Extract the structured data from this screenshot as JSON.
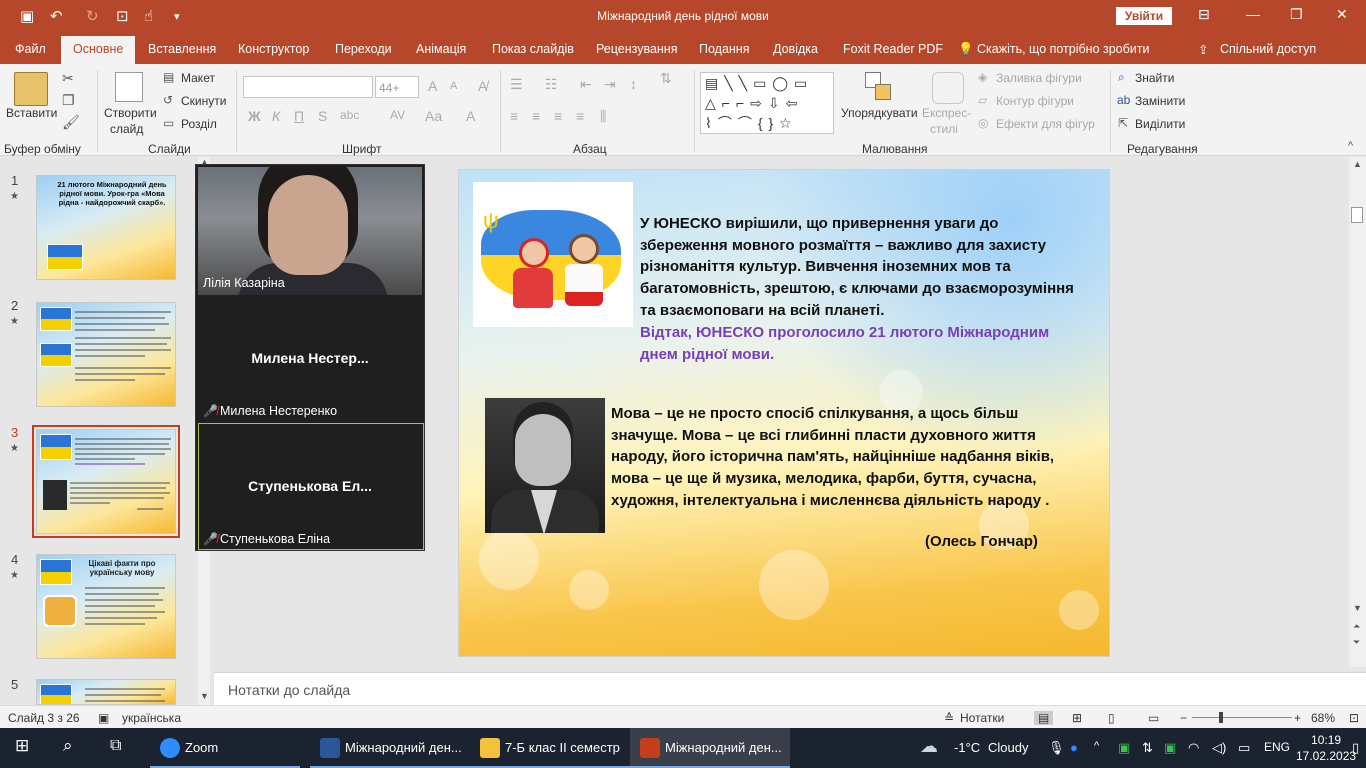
{
  "app": {
    "window_title": "Міжнародний день рідної мови",
    "sign_in": "Увійти"
  },
  "tabs": [
    "Файл",
    "Основне",
    "Вставлення",
    "Конструктор",
    "Переходи",
    "Анімація",
    "Показ слайдів",
    "Рецензування",
    "Подання",
    "Довідка",
    "Foxit Reader PDF"
  ],
  "tell_me": "Скажіть, що потрібно зробити",
  "share": "Спільний доступ",
  "ribbon": {
    "paste": "Вставити",
    "clipboard_group": "Буфер обміну",
    "new_slide_1": "Створити",
    "new_slide_2": "слайд",
    "layout": "Макет",
    "reset": "Скинути",
    "section": "Розділ",
    "slides_group": "Слайди",
    "font_size": "44+",
    "font_group": "Шрифт",
    "paragraph_group": "Абзац",
    "arrange": "Упорядкувати",
    "quick_styles_1": "Експрес-",
    "quick_styles_2": "стилі",
    "shape_fill": "Заливка фігури",
    "shape_outline": "Контур фігури",
    "shape_effects": "Ефекти для фігур",
    "drawing_group": "Малювання",
    "find": "Знайти",
    "replace": "Замінити",
    "select": "Виділити",
    "editing_group": "Редагування",
    "bold": "Ж",
    "italic": "К",
    "underline": "П"
  },
  "thumbnails": [
    {
      "num": "1",
      "title": "21 лютого Міжнародний день рідної мови. Урок-гра «Мова рідна - найдорожчий скарб»."
    },
    {
      "num": "2",
      "title": ""
    },
    {
      "num": "3",
      "title": ""
    },
    {
      "num": "4",
      "title": "Цікаві факти про українську мову"
    },
    {
      "num": "5",
      "title": ""
    }
  ],
  "video": {
    "p1_name": "Лілія Казаріна",
    "p2_center": "Милена  Нестер...",
    "p2_name": "Милена Нестеренко",
    "p3_center": "Ступенькова  Ел...",
    "p3_name": "Ступенькова Еліна"
  },
  "slide": {
    "para1": "У ЮНЕСКО вирішили, що привернення уваги до збереження мовного розмаїття – важливо для захисту різноманіття культур. Вивчення іноземних мов та багатомовність, зрештою, є ключами до взаєморозуміння та взаємоповаги на всій планеті.",
    "para1_purple": "Відтак, ЮНЕСКО проголосило 21 лютого Міжнародним днем рідної мови.",
    "para2": "Мова – це не просто спосіб спілкування, а щось більш значуще. Мова – це всі глибинні пласти духовного життя народу, його історична пам'ять, найцінніше надбання віків, мова – це ще й музика, мелодика, фарби, буття, сучасна, художня, інтелектуальна і мисленнєва діяльність народу .",
    "author": "(Олесь Гончар)"
  },
  "notes_placeholder": "Нотатки до слайда",
  "status": {
    "slide_of": "Слайд 3 з 26",
    "language": "українська",
    "notes": "Нотатки",
    "zoom": "68%"
  },
  "taskbar": {
    "zoom": "Zoom",
    "word": "Міжнародний ден...",
    "folder": "7-Б клас ІІ семестр",
    "ppt": "Міжнародний ден...",
    "weather_temp": "-1°C",
    "weather_desc": "Cloudy",
    "lang": "ENG",
    "time": "10:19",
    "date": "17.02.2023"
  }
}
